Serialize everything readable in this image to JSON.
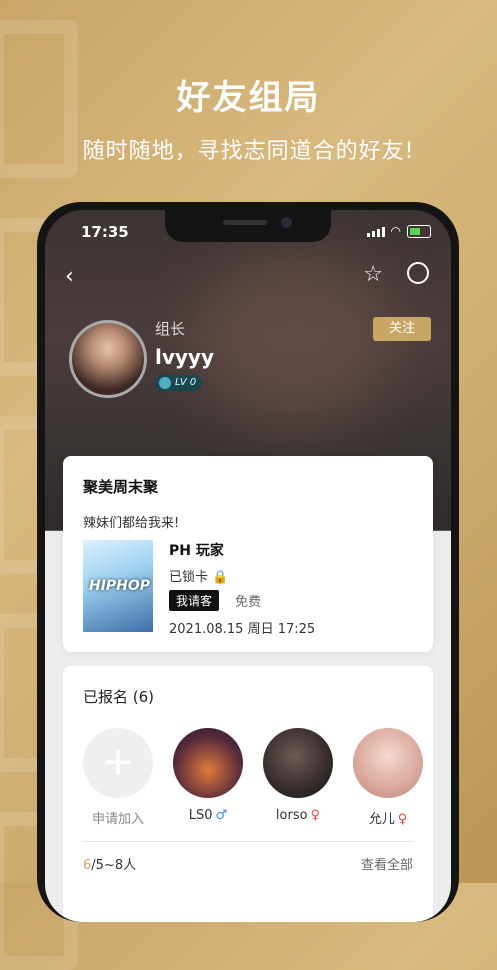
{
  "hero": {
    "title": "好友组局",
    "subtitle": "随时随地，寻找志同道合的好友!"
  },
  "status_bar": {
    "time": "17:35"
  },
  "profile": {
    "role": "组长",
    "username": "lvyyy",
    "level": "LV 0",
    "follow_label": "关注"
  },
  "event": {
    "title": "聚美周末聚",
    "description": "辣妹们都给我来!",
    "venue_name": "PH 玩家",
    "venue_logo_text": "HIPHOP",
    "booking": "已锁卡",
    "treat_badge": "我请客",
    "price": "免费",
    "datetime": "2021.08.15 周日 17:25"
  },
  "signup": {
    "header": "已报名 (6)",
    "join_label": "申请加入",
    "members": [
      {
        "name": "LS0",
        "gender": "♂"
      },
      {
        "name": "lorso",
        "gender": "♀"
      },
      {
        "name": "允儿",
        "gender": "♀"
      }
    ],
    "count_current": "6",
    "count_range": "/5~8人",
    "view_all": "查看全部"
  },
  "icons": {
    "back": "chevron-left-icon",
    "favorite": "star-icon",
    "share": "share-icon",
    "add": "plus-icon",
    "lock": "lock-icon"
  }
}
